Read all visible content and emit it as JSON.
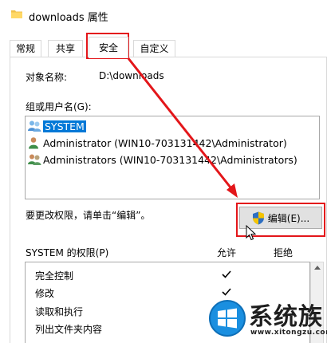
{
  "window": {
    "title": "downloads 属性"
  },
  "tabs": [
    {
      "label": "常规"
    },
    {
      "label": "共享"
    },
    {
      "label": "安全",
      "active": true
    },
    {
      "label": "自定义"
    }
  ],
  "security": {
    "object_label": "对象名称:",
    "object_value": "D:\\downloads",
    "groups_label": "组或用户名(G):",
    "users": [
      {
        "name": "SYSTEM",
        "icon": "system-users-icon",
        "selected": true
      },
      {
        "name": "Administrator (WIN10-703131442\\Administrator)",
        "icon": "user-icon",
        "selected": false
      },
      {
        "name": "Administrators (WIN10-703131442\\Administrators)",
        "icon": "group-users-icon",
        "selected": false
      }
    ],
    "change_hint": "要更改权限，请单击“编辑”。",
    "edit_button": "编辑(E)...",
    "permissions_label": "SYSTEM 的权限(P)",
    "allow_label": "允许",
    "deny_label": "拒绝",
    "permissions": [
      {
        "name": "完全控制",
        "allow": true,
        "deny": false
      },
      {
        "name": "修改",
        "allow": true,
        "deny": false
      },
      {
        "name": "读取和执行",
        "allow": true,
        "deny": false
      },
      {
        "name": "列出文件夹内容",
        "allow": true,
        "deny": false
      }
    ]
  },
  "watermark": {
    "title": "系统族",
    "url": "www.xitongzu.com"
  },
  "colors": {
    "highlight": "#0078d7",
    "annotation": "#e3161a",
    "button": "#e1e1e1"
  }
}
